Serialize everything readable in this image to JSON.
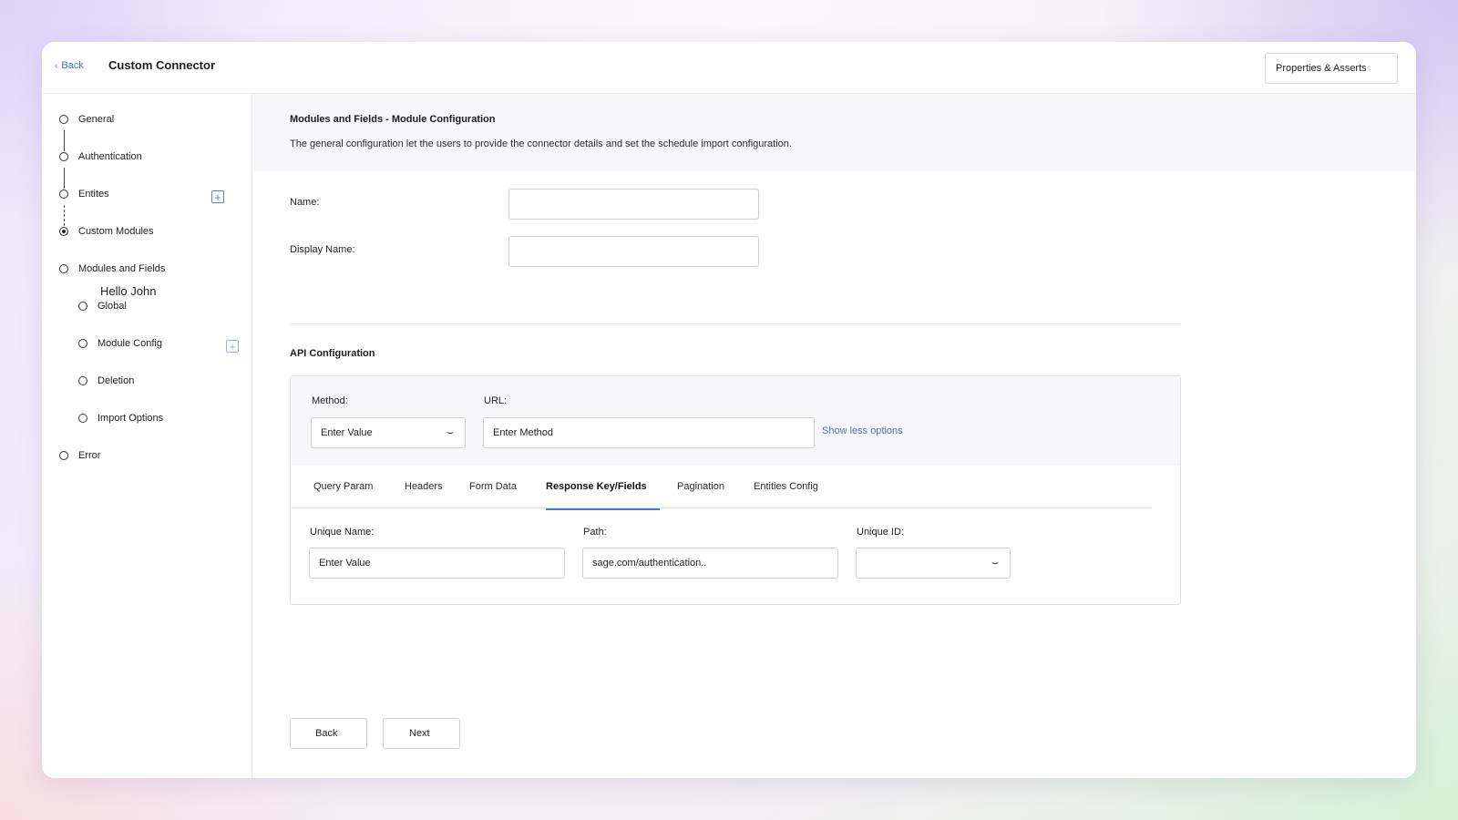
{
  "header": {
    "back_label": "Back",
    "title": "Custom Connector",
    "properties_button": "Properties & Asserts"
  },
  "sidebar": {
    "steps": [
      {
        "label": "General",
        "active": false
      },
      {
        "label": "Authentication",
        "active": false
      },
      {
        "label": "Entites",
        "active": false
      },
      {
        "label": "Custom Modules",
        "active": true
      },
      {
        "label": "Modules and Fields",
        "active": false
      },
      {
        "label": "Error",
        "active": false
      }
    ],
    "greeting": "Hello John",
    "substeps": [
      {
        "label": "Global"
      },
      {
        "label": "Module Config"
      },
      {
        "label": "Deletion"
      },
      {
        "label": "Import Options"
      }
    ]
  },
  "section": {
    "title": "Modules and Fields - Module Configuration",
    "description": "The general configuration let the users to provide the connector details and set the schedule import configuration."
  },
  "form": {
    "name_label": "Name:",
    "name_value": "",
    "display_name_label": "Display Name:",
    "display_name_value": ""
  },
  "api": {
    "title": "API Configuration",
    "method_label": "Method:",
    "method_value": "Enter Value",
    "url_label": "URL:",
    "url_value": "Enter Method",
    "show_less": "Show less options",
    "tabs": [
      "Query Param",
      "Headers",
      "Form Data",
      "Response Key/Fields",
      "Pagination",
      "Entities Config"
    ],
    "active_tab": "Response Key/Fields",
    "unique_name_label": "Unique Name:",
    "unique_name_value": "Enter Value",
    "path_label": "Path:",
    "path_value": "sage.com/authentication..",
    "unique_id_label": "Unique ID:",
    "unique_id_value": ""
  },
  "footer": {
    "back_button": "Back",
    "next_button": "Next"
  },
  "colors": {
    "accent": "#4a78d6",
    "link": "#4a6fd1",
    "panel_bg": "#f7f7fa"
  }
}
